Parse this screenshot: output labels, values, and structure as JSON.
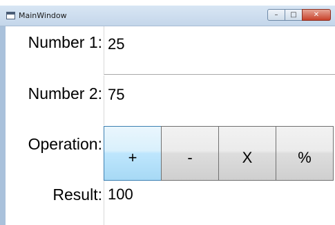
{
  "window": {
    "title": "MainWindow",
    "caption_buttons": {
      "minimize": "–",
      "maximize": "□",
      "close": "✕"
    }
  },
  "form": {
    "number1_label": "Number 1:",
    "number1_value": "25",
    "number2_label": "Number 2:",
    "number2_value": "75",
    "operation_label": "Operation:",
    "operations": [
      "+",
      "-",
      "X",
      "%"
    ],
    "result_label": "Result:",
    "result_value": "100"
  },
  "colors": {
    "active_button": "#bee6fd",
    "close_button": "#c8412a"
  }
}
